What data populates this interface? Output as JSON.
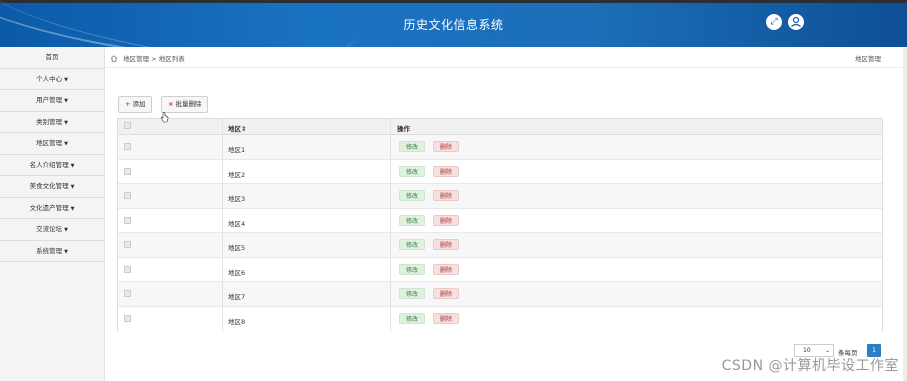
{
  "header": {
    "title": "历史文化信息系统",
    "icons": [
      "fullscreen-icon",
      "user-icon"
    ]
  },
  "sidebar": {
    "items": [
      {
        "label": "首页",
        "dropdown": false
      },
      {
        "label": "个人中心",
        "dropdown": true
      },
      {
        "label": "用户管理",
        "dropdown": true
      },
      {
        "label": "类别管理",
        "dropdown": true
      },
      {
        "label": "地区管理",
        "dropdown": true
      },
      {
        "label": "名人介绍管理",
        "dropdown": true
      },
      {
        "label": "美食文化管理",
        "dropdown": true
      },
      {
        "label": "文化遗产管理",
        "dropdown": true
      },
      {
        "label": "交流论坛",
        "dropdown": true
      },
      {
        "label": "系统管理",
        "dropdown": true
      }
    ]
  },
  "breadcrumb": {
    "section": "地区管理",
    "separator": ">",
    "page": "地区列表",
    "right_label": "地区管理"
  },
  "toolbar": {
    "add_label": "添加",
    "batch_delete_label": "批量删除"
  },
  "table": {
    "headers": {
      "name": "地区",
      "sort_icon": "⇕",
      "operation": "操作"
    },
    "rows": [
      {
        "name": "地区1"
      },
      {
        "name": "地区2"
      },
      {
        "name": "地区3"
      },
      {
        "name": "地区4"
      },
      {
        "name": "地区5"
      },
      {
        "name": "地区6"
      },
      {
        "name": "地区7"
      },
      {
        "name": "地区8"
      }
    ],
    "edit_label": "修改",
    "delete_label": "删除"
  },
  "pagination": {
    "page_size": "10",
    "per_page_label": "条每页",
    "current_page": "1"
  },
  "watermark": "CSDN @计算机毕设工作室",
  "colors": {
    "header_blue": "#1a73c2",
    "page_active": "#2a7fc9",
    "edit_green": "#3d7a3d",
    "delete_red": "#aa3333"
  }
}
